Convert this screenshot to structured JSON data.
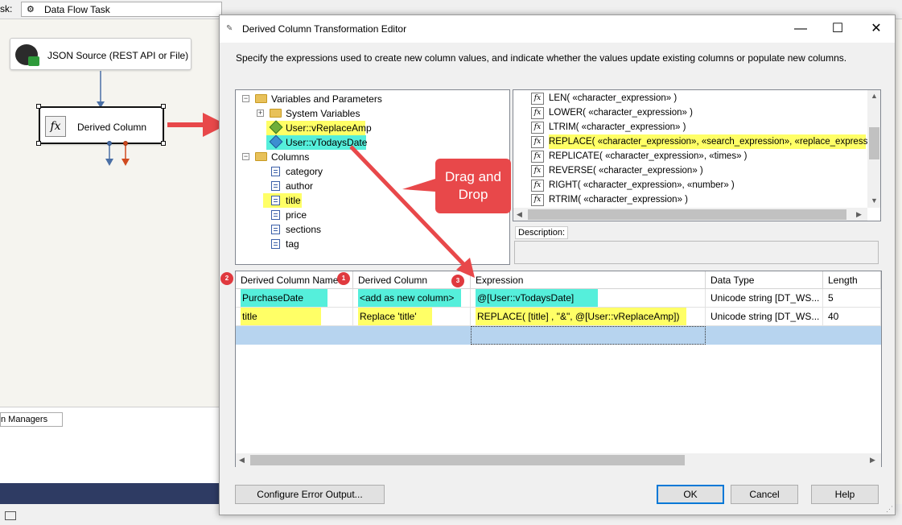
{
  "topbar": {
    "task_label": "sk:",
    "task_value": "Data Flow Task"
  },
  "designer": {
    "json_source": "JSON Source (REST API or File)",
    "derived_column": "Derived Column",
    "connection_managers_tab": "n Managers"
  },
  "dialog": {
    "title": "Derived Column Transformation Editor",
    "instructions": "Specify the expressions used to create new column values, and indicate whether the values update existing columns or populate new columns.",
    "tree": {
      "variables_folder": "Variables and Parameters",
      "system_variables": "System Variables",
      "var1": "User::vReplaceAmp",
      "var2": "User::vTodaysDate",
      "columns_folder": "Columns",
      "columns": [
        "category",
        "author",
        "title",
        "price",
        "sections",
        "tag"
      ]
    },
    "functions": [
      "LEN( «character_expression» )",
      "LOWER( «character_expression» )",
      "LTRIM( «character_expression» )",
      "REPLACE( «character_expression», «search_expression», «replace_expression» )",
      "REPLICATE( «character_expression», «times» )",
      "REVERSE( «character_expression» )",
      "RIGHT( «character_expression», «number» )",
      "RTRIM( «character_expression» )"
    ],
    "description_label": "Description:",
    "grid": {
      "headers": [
        "Derived Column Name",
        "Derived Column",
        "Expression",
        "Data Type",
        "Length"
      ],
      "rows": [
        [
          "PurchaseDate",
          "<add as new column>",
          "@[User::vTodaysDate]",
          "Unicode string [DT_WS...",
          "5"
        ],
        [
          "title",
          "Replace 'title'",
          "REPLACE( [title] , \"&\", @[User::vReplaceAmp])",
          "Unicode string [DT_WS...",
          "40"
        ]
      ]
    },
    "buttons": {
      "configure": "Configure Error Output...",
      "ok": "OK",
      "cancel": "Cancel",
      "help": "Help"
    }
  },
  "annotations": {
    "callout": "Drag and Drop",
    "badges": [
      "2",
      "1",
      "3"
    ],
    "arrow_color": "#e8484a"
  }
}
